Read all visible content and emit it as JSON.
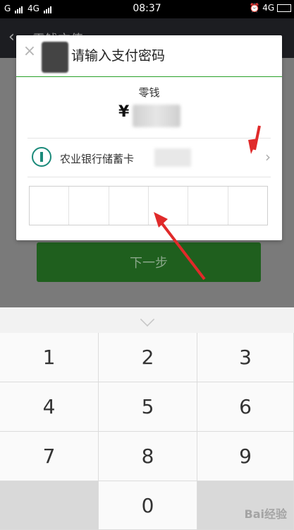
{
  "status_bar": {
    "carrier_left": "G",
    "network_left": "4G",
    "time": "08:37",
    "network_right": "4G"
  },
  "app": {
    "title": "零钱充值",
    "next_button": "下一步"
  },
  "dialog": {
    "title": "请输入支付密码",
    "balance_label": "零钱",
    "currency_symbol": "¥",
    "bank_name": "农业银行储蓄卡",
    "password_cells": [
      "",
      "",
      "",
      "",
      "",
      ""
    ]
  },
  "keyboard": {
    "keys": [
      "1",
      "2",
      "3",
      "4",
      "5",
      "6",
      "7",
      "8",
      "9",
      "",
      "0",
      ""
    ]
  },
  "watermark": "Bai经验",
  "colors": {
    "accent_green": "#2aa12a",
    "arrow_red": "#e02a2a",
    "bank_logo": "#1b8a7a"
  },
  "icons": [
    "close-icon",
    "chevron-right-icon",
    "collapse-keyboard-icon",
    "bank-logo-icon",
    "back-arrow-icon"
  ]
}
